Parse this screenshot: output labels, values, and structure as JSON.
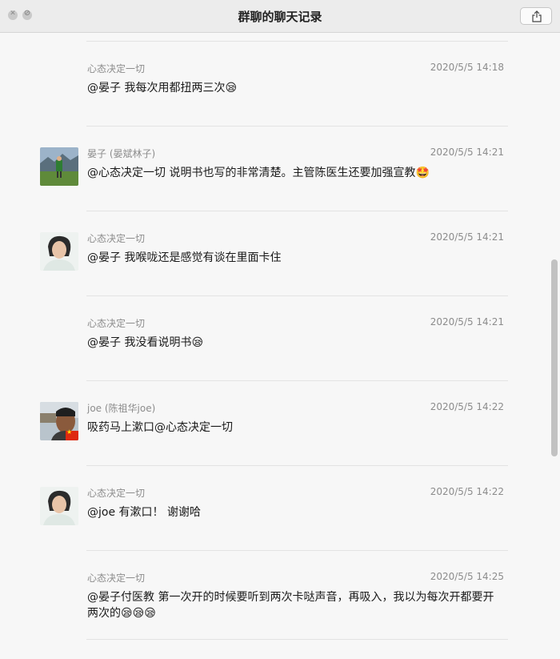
{
  "window": {
    "title": "群聊的聊天记录"
  },
  "messages": [
    {
      "sender": "心态决定一切",
      "time": "2020/5/5 14:18",
      "text": "@晏子 我每次用都扭两三次😪",
      "avatar": "none"
    },
    {
      "sender": "晏子 (晏斌林子)",
      "time": "2020/5/5 14:21",
      "text": "@心态决定一切 说明书也写的非常清楚。主管陈医生还要加强宣教🤩",
      "avatar": "landscape-photo"
    },
    {
      "sender": "心态决定一切",
      "time": "2020/5/5 14:21",
      "text": "@晏子 我喉咙还是感觉有谈在里面卡住",
      "avatar": "woman-portrait"
    },
    {
      "sender": "心态决定一切",
      "time": "2020/5/5 14:21",
      "text": "@晏子 我没看说明书😪",
      "avatar": "none"
    },
    {
      "sender": "joe (陈祖华joe)",
      "time": "2020/5/5 14:22",
      "text": "吸药马上漱口@心态决定一切",
      "avatar": "man-portrait-flag"
    },
    {
      "sender": "心态决定一切",
      "time": "2020/5/5 14:22",
      "text": "@joe 有漱口！ 谢谢哈",
      "avatar": "woman-portrait"
    },
    {
      "sender": "心态决定一切",
      "time": "2020/5/5 14:25",
      "text": "@晏子付医教 第一次开的时候要听到两次卡哒声音，再吸入，我以为每次开都要开两次的😪😪😪",
      "avatar": "none"
    }
  ],
  "colors": {
    "titlebar": "#ececec",
    "meta_text": "#8c8c8c",
    "divider": "#e3e3e3"
  },
  "icons": {
    "close": "close-icon",
    "minimize": "minimize-icon",
    "share": "share-icon"
  }
}
